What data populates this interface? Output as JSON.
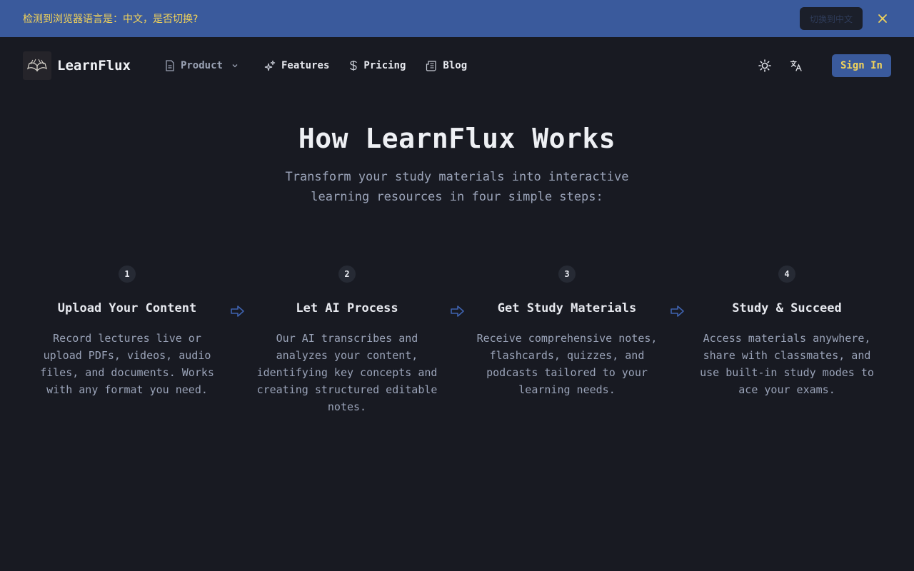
{
  "banner": {
    "message": "检测到浏览器语言是：中文，是否切换?",
    "switch_label": "切换到中文"
  },
  "nav": {
    "brand": "LearnFlux",
    "links": [
      {
        "label": "Product",
        "icon": "document-icon"
      },
      {
        "label": "Features",
        "icon": "sparkles-icon"
      },
      {
        "label": "Pricing",
        "icon": "dollar-icon"
      },
      {
        "label": "Blog",
        "icon": "newspaper-icon"
      }
    ],
    "sign_in": "Sign In"
  },
  "hero": {
    "title": "How LearnFlux Works",
    "subtitle": "Transform your study materials into interactive learning resources in four simple steps:"
  },
  "steps": [
    {
      "num": "1",
      "title": "Upload Your Content",
      "desc": "Record lectures live or upload PDFs, videos, audio files, and documents. Works with any format you need."
    },
    {
      "num": "2",
      "title": "Let AI Process",
      "desc": "Our AI transcribes and analyzes your content, identifying key concepts and creating structured editable notes."
    },
    {
      "num": "3",
      "title": "Get Study Materials",
      "desc": "Receive comprehensive notes, flashcards, quizzes, and podcasts tailored to your learning needs."
    },
    {
      "num": "4",
      "title": "Study & Succeed",
      "desc": "Access materials anywhere, share with classmates, and use built-in study modes to ace your exams."
    }
  ],
  "colors": {
    "background": "#181a22",
    "accent": "#3a5a9c",
    "highlight": "#f2d35a"
  }
}
